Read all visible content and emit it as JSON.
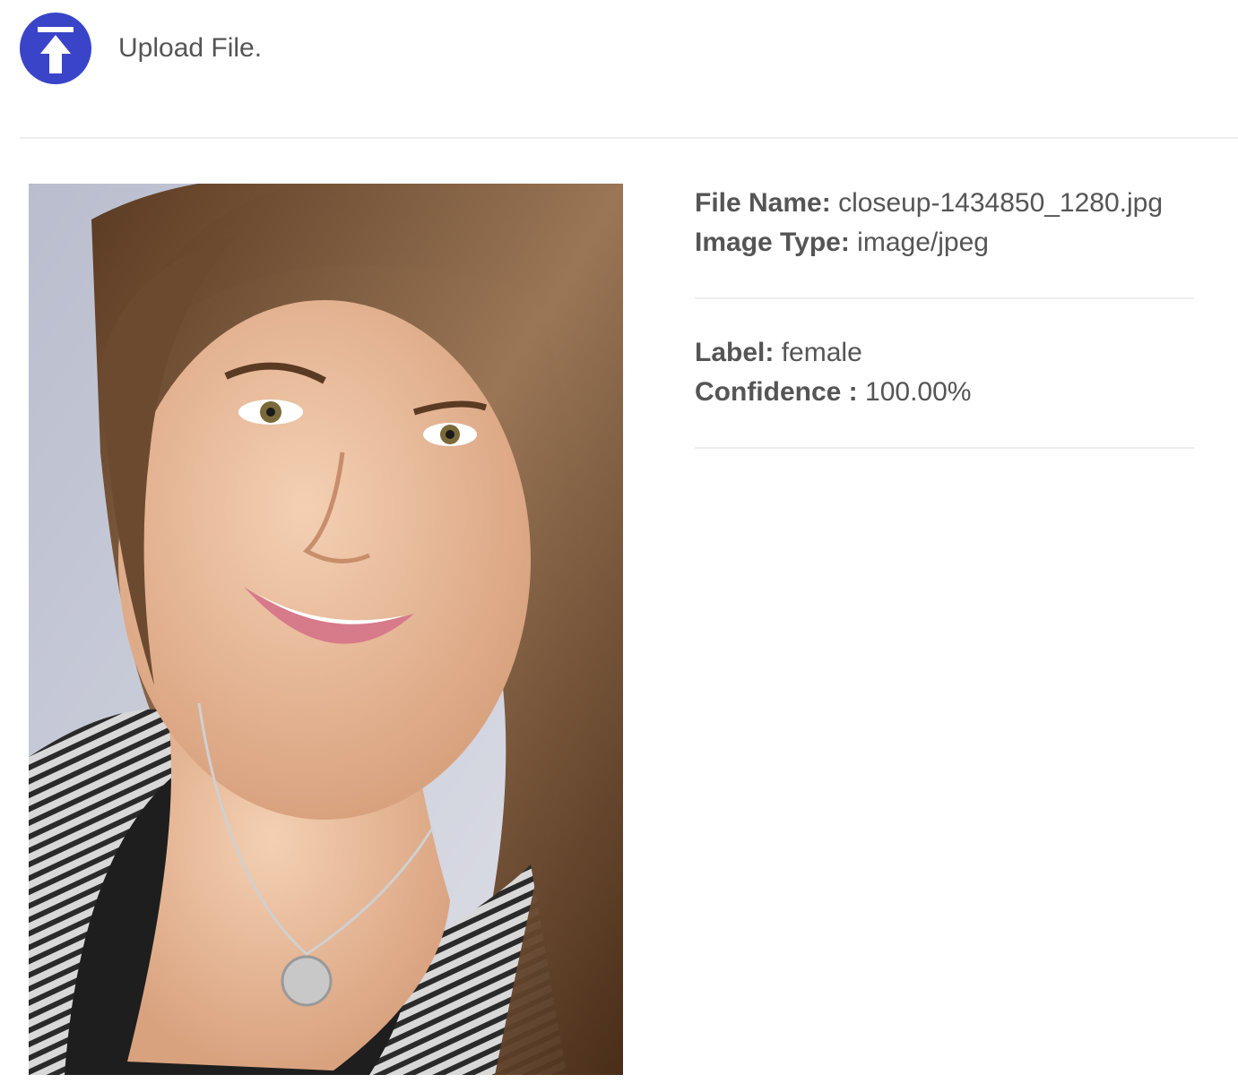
{
  "header": {
    "upload_icon": "upload-arrow-icon",
    "upload_label": "Upload File.",
    "accent_color": "#3a44c8"
  },
  "preview": {
    "image_description": "upload-preview-photo"
  },
  "file_info": {
    "name_label": "File Name:",
    "name_value": "closeup-1434850_1280.jpg",
    "type_label": "Image Type:",
    "type_value": "image/jpeg"
  },
  "prediction": {
    "label_label": "Label:",
    "label_value": "female",
    "confidence_label": "Confidence :",
    "confidence_value": "100.00%"
  }
}
